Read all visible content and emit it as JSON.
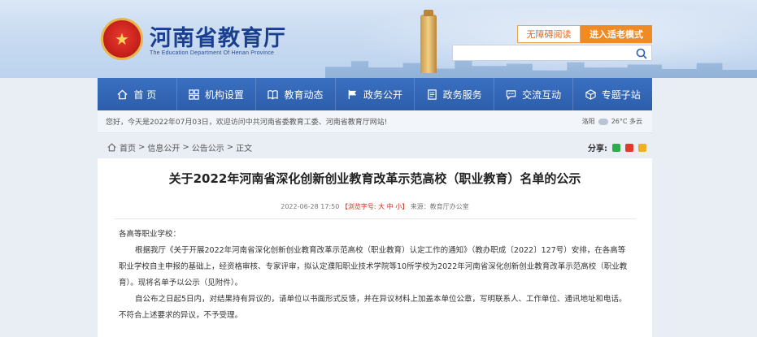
{
  "header": {
    "title": "河南省教育厅",
    "subtitle": "The Education Department Of Henan Province",
    "accessible_label": "无障碍阅读",
    "elder_mode_label": "进入适老模式",
    "search_placeholder": ""
  },
  "nav": {
    "items": [
      {
        "label": "首 页",
        "icon": "home-icon"
      },
      {
        "label": "机构设置",
        "icon": "grid-icon"
      },
      {
        "label": "教育动态",
        "icon": "book-icon"
      },
      {
        "label": "政务公开",
        "icon": "flag-icon"
      },
      {
        "label": "政务服务",
        "icon": "doc-icon"
      },
      {
        "label": "交流互动",
        "icon": "chat-icon"
      },
      {
        "label": "专题子站",
        "icon": "cube-icon"
      }
    ]
  },
  "welcome": {
    "text": "您好，今天是2022年07月03日，欢迎访问中共河南省委教育工委、河南省教育厅网站!",
    "city": "洛阳",
    "weather": "26°C 多云"
  },
  "breadcrumb": {
    "home": "首页",
    "sep": ">",
    "items": [
      "信息公开",
      "公告公示",
      "正文"
    ]
  },
  "share": {
    "label": "分享:"
  },
  "article": {
    "title": "关于2022年河南省深化创新创业教育改革示范高校（职业教育）名单的公示",
    "date": "2022-06-28 17:50",
    "font_size_label": "【浏览字号: 大 中 小】",
    "source": "来源：教育厅办公室",
    "greeting": "各高等职业学校：",
    "para1": "根据我厅《关于开展2022年河南省深化创新创业教育改革示范高校（职业教育）认定工作的通知》（教办职成〔2022〕127号）安排，在各高等职业学校自主申报的基础上，经资格审核、专家评审，拟认定濮阳职业技术学院等10所学校为2022年河南省深化创新创业教育改革示范高校（职业教育）。现将名单予以公示（见附件）。",
    "para2": "自公布之日起5日内，对结果持有异议的，请单位以书面形式反馈，并在异议材料上加盖本单位公章，写明联系人、工作单位、通讯地址和电话。不符合上述要求的异议，不予受理。"
  },
  "colors": {
    "nav_bg": "#2c5eab",
    "title_blue": "#1b3f8f",
    "accent_orange": "#f08a24",
    "red": "#d42a1c"
  }
}
